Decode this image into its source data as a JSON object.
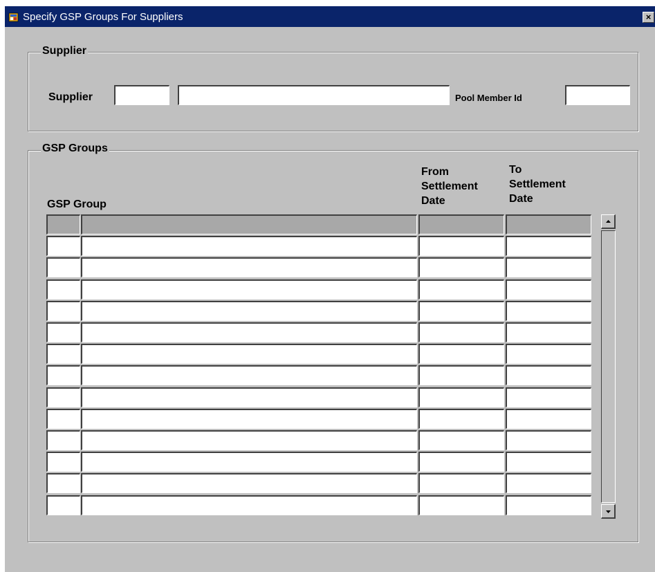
{
  "window": {
    "title": "Specify GSP Groups For Suppliers",
    "close_label": "×"
  },
  "supplier_section": {
    "label": "Supplier",
    "supplier_label": "Supplier",
    "supplier_code_value": "",
    "supplier_name_value": "",
    "pool_member_label": "Pool Member Id",
    "pool_member_value": ""
  },
  "gsp_section": {
    "label": "GSP Groups",
    "columns": {
      "gsp_group": "GSP Group",
      "from_line1": "From",
      "from_line2": "Settlement",
      "from_line3": "Date",
      "to_line1": "To",
      "to_line2": "Settlement",
      "to_line3": "Date"
    },
    "row_count": 14
  },
  "colors": {
    "titlebar": "#0a246a",
    "window_bg": "#c0c0c0",
    "current_row": "#a8a8a8"
  },
  "icons": {
    "title_icon": "oracle-forms-window-icon",
    "scroll_up": "scroll-up-arrow-icon",
    "scroll_down": "scroll-down-arrow-icon"
  }
}
